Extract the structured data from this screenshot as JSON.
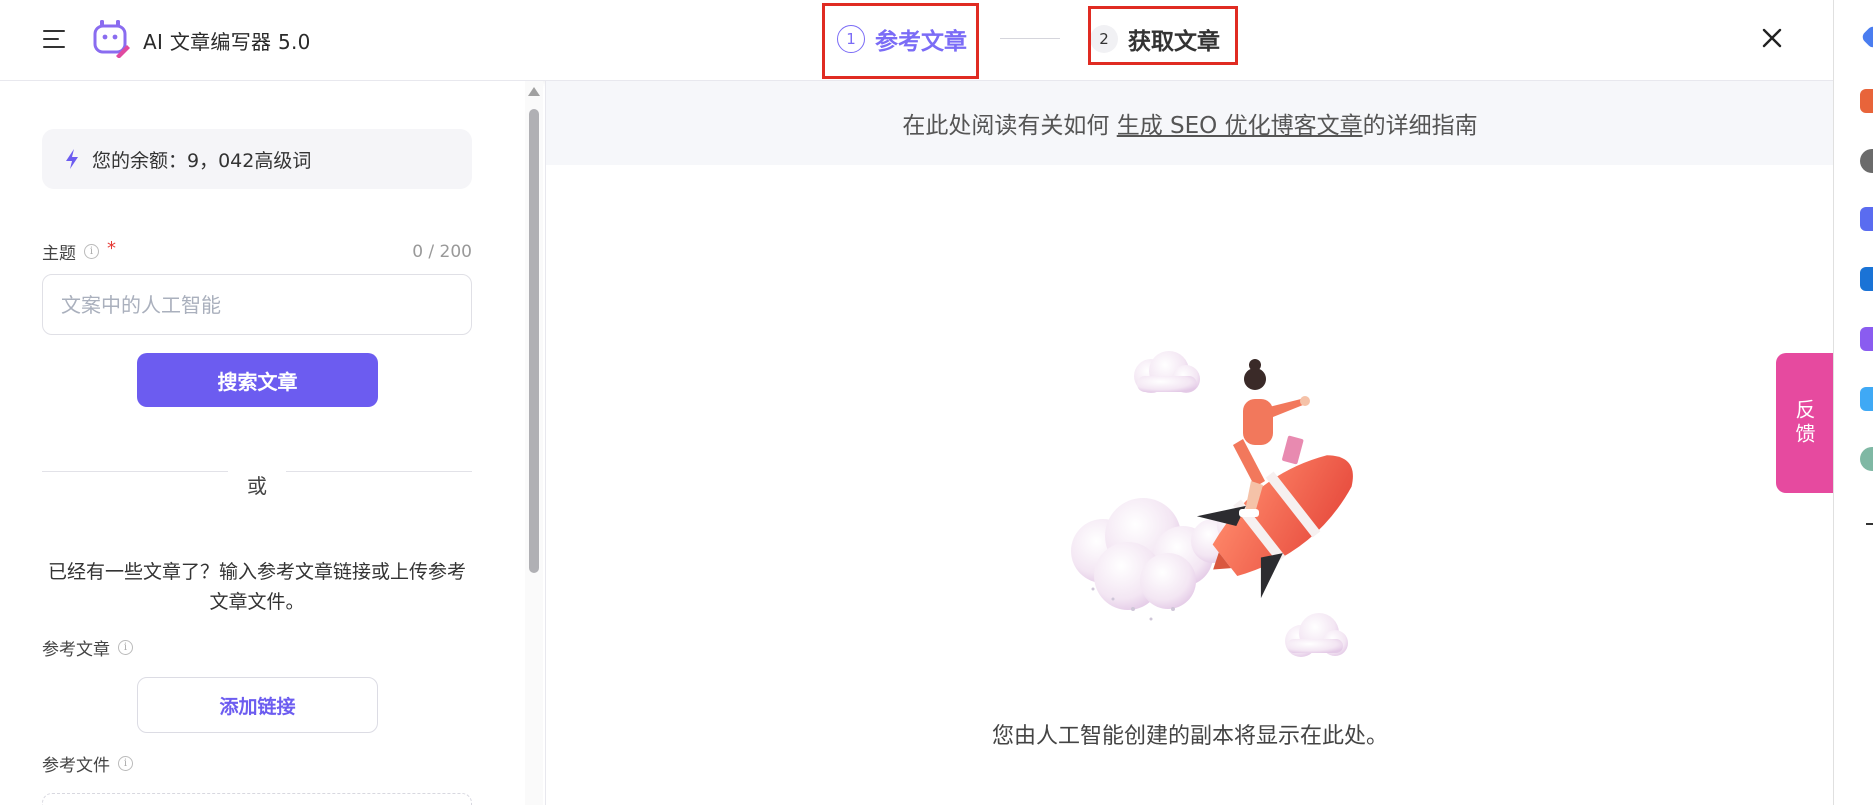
{
  "header": {
    "app_title": "AI 文章编写器 5.0",
    "steps": [
      {
        "number": "1",
        "label": "参考文章",
        "state": "active"
      },
      {
        "number": "2",
        "label": "获取文章",
        "state": "inactive"
      }
    ]
  },
  "sidebar": {
    "balance": "您的余额：9，042高级词",
    "topic": {
      "label": "主题",
      "required_mark": "*",
      "counter": "0 / 200",
      "placeholder": "文案中的人工智能",
      "value": ""
    },
    "search_button": "搜索文章",
    "or_text": "或",
    "hint": "已经有一些文章了？输入参考文章链接或上传参考文章文件。",
    "reference_article_label": "参考文章",
    "add_link_button": "添加链接",
    "reference_file_label": "参考文件"
  },
  "content": {
    "guide_prefix": "在此处阅读有关如何 ",
    "guide_link": "生成 SEO 优化博客文章",
    "guide_suffix": "的详细指南",
    "empty_state_text": "您由人工智能创建的副本将显示在此处。"
  },
  "feedback_tab": "反馈",
  "colors": {
    "accent": "#6c5cf0",
    "feedback": "#e64a9f",
    "annotation": "#e02b22"
  }
}
